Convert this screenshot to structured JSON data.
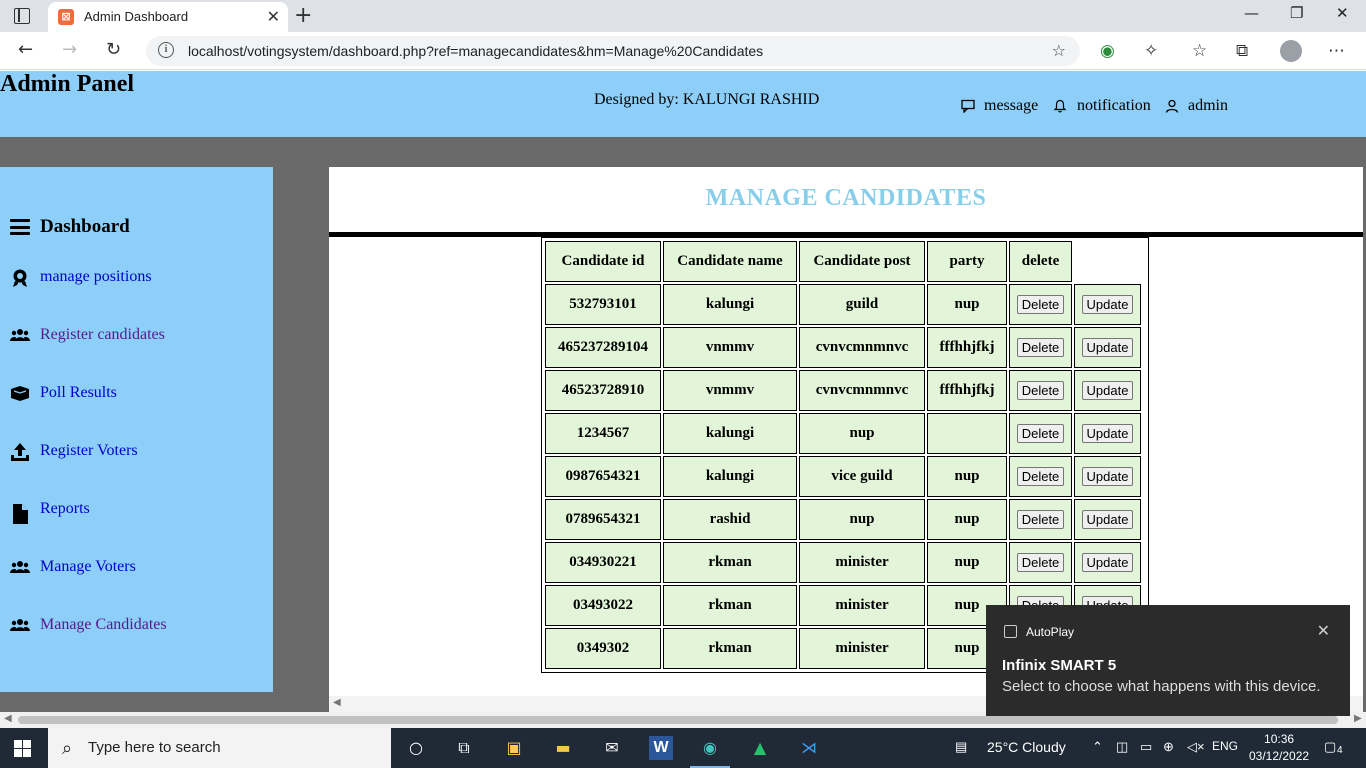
{
  "browser": {
    "tab_title": "Admin Dashboard",
    "url": "localhost/votingsystem/dashboard.php?ref=managecandidates&hm=Manage%20Candidates"
  },
  "header": {
    "panel_title": "Admin Panel",
    "designed_by": "Designed by: KALUNGI RASHID",
    "message": "message",
    "notification": "notification",
    "admin": "admin"
  },
  "sidebar": {
    "title": "Dashboard",
    "items": [
      {
        "label": "manage positions",
        "icon": "award-icon"
      },
      {
        "label": "Register candidates",
        "icon": "users-icon"
      },
      {
        "label": "Poll Results",
        "icon": "box-icon"
      },
      {
        "label": "Register Voters",
        "icon": "upload-icon"
      },
      {
        "label": "Reports",
        "icon": "file-icon"
      },
      {
        "label": "Manage Voters",
        "icon": "users-icon"
      },
      {
        "label": "Manage Candidates",
        "icon": "users-icon"
      }
    ]
  },
  "main": {
    "title": "MANAGE CANDIDATES",
    "columns": [
      "Candidate id",
      "Candidate name",
      "Candidate post",
      "party",
      "delete"
    ],
    "delete_label": "Delete",
    "update_label": "Update",
    "rows": [
      [
        "532793101",
        "kalungi",
        "guild",
        "nup"
      ],
      [
        "465237289104",
        "vnmmv",
        "cvnvcmnmnvc",
        "fffhhjfkj"
      ],
      [
        "46523728910",
        "vnmmv",
        "cvnvcmnmnvc",
        "fffhhjfkj"
      ],
      [
        "1234567",
        "kalungi",
        "nup",
        ""
      ],
      [
        "0987654321",
        "kalungi",
        "vice guild",
        "nup"
      ],
      [
        "0789654321",
        "rashid",
        "nup",
        "nup"
      ],
      [
        "034930221",
        "rkman",
        "minister",
        "nup"
      ],
      [
        "03493022",
        "rkman",
        "minister",
        "nup"
      ],
      [
        "0349302",
        "rkman",
        "minister",
        "nup"
      ]
    ]
  },
  "toast": {
    "app": "AutoPlay",
    "title": "Infinix SMART 5",
    "message": "Select to choose what happens with this device."
  },
  "taskbar": {
    "search_placeholder": "Type here to search",
    "weather": "25°C  Cloudy",
    "language": "ENG",
    "time": "10:36",
    "date": "03/12/2022",
    "notification_count": "4"
  }
}
